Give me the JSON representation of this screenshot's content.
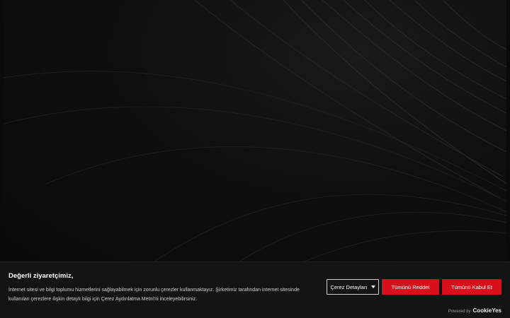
{
  "hero": {
    "background_color": "#0a0a0a"
  },
  "cookie_banner": {
    "title": "Değerli ziyaretçimiz,",
    "message_line1": "İnternet sitesi ve bilgi toplumu hizmetlerini sağlayabilmek için zorunlu çerezler kullanmaktayız. Şirketimiz tarafından internet sitesinde",
    "message_line2": "kullanılan çerezlere ilişkin detaylı bilgi için Çerez Aydınlatma Metni'ni inceleyebilirsiniz.",
    "details_label": "Çerez Detayları",
    "reject_label": "Tümünü Reddet",
    "accept_label": "Tümünü Kabul Et",
    "powered_label": "Powered by",
    "powered_brand": "CookieYes",
    "accent_color": "#d8101c",
    "background_color": "#141414"
  }
}
